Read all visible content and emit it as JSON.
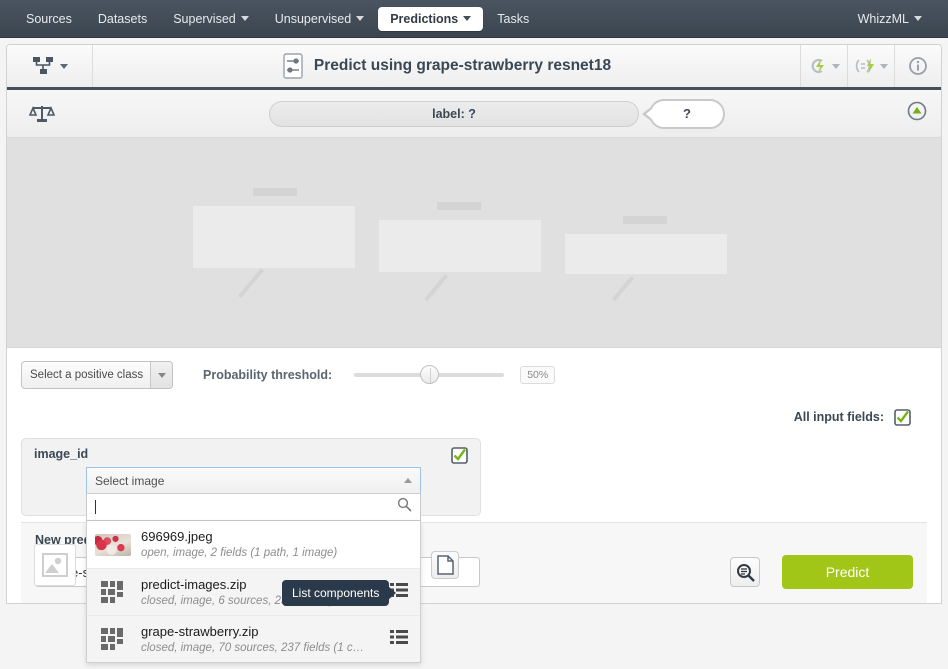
{
  "topnav": {
    "items": [
      {
        "label": "Sources",
        "dropdown": false,
        "active": false
      },
      {
        "label": "Datasets",
        "dropdown": false,
        "active": false
      },
      {
        "label": "Supervised",
        "dropdown": true,
        "active": false
      },
      {
        "label": "Unsupervised",
        "dropdown": true,
        "active": false
      },
      {
        "label": "Predictions",
        "dropdown": true,
        "active": true
      },
      {
        "label": "Tasks",
        "dropdown": false,
        "active": false
      }
    ],
    "right": {
      "label": "WhizzML",
      "dropdown": true
    }
  },
  "header": {
    "title": "Predict using grape-strawberry resnet18",
    "left_icon": "model-tree-icon",
    "title_icon": "sliders-icon",
    "actions": [
      {
        "icon": "cloud-bolt-icon",
        "dropdown": true
      },
      {
        "icon": "batch-bolt-icon",
        "dropdown": true
      },
      {
        "icon": "info-circle-icon",
        "dropdown": false
      }
    ]
  },
  "objective_bar": {
    "scales_icon": "balance-scales-icon",
    "field_label": "label: ?",
    "prediction_label": "?",
    "collapse_icon": "green-circle-up-icon"
  },
  "controls": {
    "positive_class_label": "Select a positive class",
    "threshold_label": "Probability threshold:",
    "threshold_value": "50%",
    "threshold_percent": 50,
    "all_input_fields_label": "All input fields:",
    "all_input_fields_checked": true
  },
  "field": {
    "name": "image_id",
    "checked": true,
    "placeholder_icon": "image-placeholder-icon",
    "doc_button_icon": "document-icon"
  },
  "combo": {
    "header_label": "Select image",
    "search_value": "",
    "search_icon": "magnifier-icon",
    "caret_icon": "caret-up-icon",
    "options": [
      {
        "title": "696969.jpeg",
        "subtitle": "open, image, 2 fields (1 path, 1 image)",
        "icon": "image-thumbnail",
        "has_list_icon": false
      },
      {
        "title": "predict-images.zip",
        "subtitle": "closed, image, 6 sources, 236 fields (234 ...",
        "icon": "composite-sources-icon",
        "has_list_icon": true
      },
      {
        "title": "grape-strawberry.zip",
        "subtitle": "closed, image, 70 sources, 237 fields (1 c…",
        "icon": "composite-sources-icon",
        "has_list_icon": true
      }
    ]
  },
  "tooltip": {
    "text": "List components"
  },
  "new_prediction": {
    "label": "New prediction",
    "input_value": "grape-strawberry resnet18",
    "search_button_icon": "inspect-magnifier-icon",
    "predict_button_label": "Predict"
  },
  "colors": {
    "nav_bg": "#3b4550",
    "accent_green": "#a2c617",
    "header_underline": "#434f5b",
    "tooltip_bg": "#2b3a4a",
    "check_green": "#76b51a"
  }
}
